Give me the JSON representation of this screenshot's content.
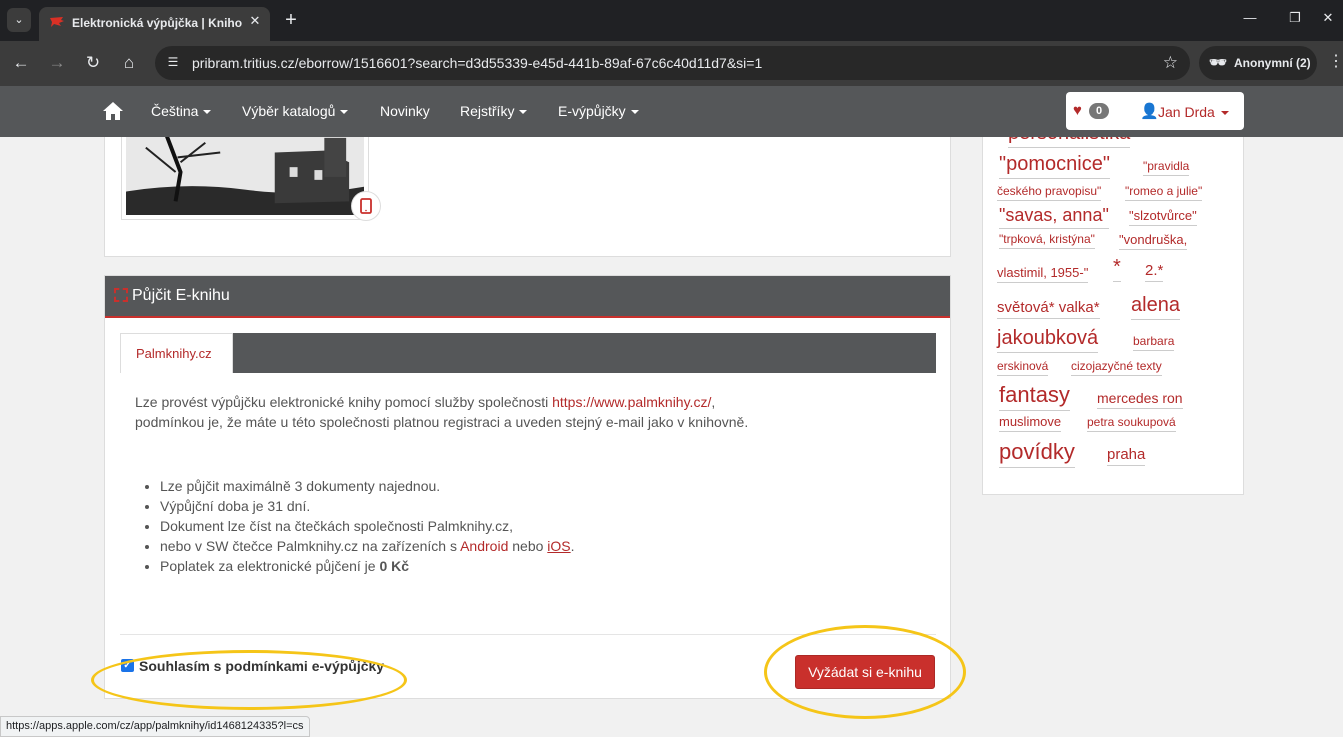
{
  "browser": {
    "tab_title": "Elektronická výpůjčka | Knihovna",
    "url": "pribram.tritius.cz/eborrow/1516601?search=d3d55339-e45d-441b-89af-67c6c40d11d7&si=1",
    "incognito_label": "Anonymní (2)",
    "status_url": "https://apps.apple.com/cz/app/palmknihy/id1468124335?l=cs"
  },
  "nav": {
    "items": [
      "Čeština",
      "Výběr katalogů",
      "Novinky",
      "Rejstříky",
      "E-výpůjčky"
    ],
    "favorites_count": "0",
    "user_name": "Jan Drda"
  },
  "panel": {
    "title": "Půjčit E-knihu",
    "tab_label": "Palmknihy.cz",
    "intro_before": "Lze provést výpůjčku elektronické knihy pomocí služby společnosti ",
    "intro_link": "https://www.palmknihy.cz/",
    "intro_after": ",",
    "intro_line2": "podmínkou je, že máte u této společnosti platnou registraci a uveden stejný e-mail jako v knihovně.",
    "rules": {
      "r1": "Lze půjčit maximálně 3 dokumenty najednou.",
      "r2": "Výpůjční doba je 31 dní.",
      "r3": "Dokument lze číst na čtečkách společnosti Palmknihy.cz,",
      "r4_before": "nebo v SW čtečce Palmknihy.cz na zařízeních s ",
      "r4_android": "Android",
      "r4_mid": " nebo ",
      "r4_ios": "iOS",
      "r4_after": ".",
      "r5_before": "Poplatek za elektronické půjčení je ",
      "r5_fee": "0 Kč"
    },
    "agree_label": "Souhlasím s podmínkami e-výpůjčky",
    "agree_checked": true,
    "request_button": "Vyžádat si e-knihu"
  },
  "tags": {
    "t0": "personalistika",
    "t1": "\"pomocnice\"",
    "t2": "\"pravidla",
    "t3": "českého pravopisu\"",
    "t4": "\"romeo a julie\"",
    "t5": "\"savas, anna\"",
    "t6": "\"slzotvůrce\"",
    "t7": "\"trpková, kristýna\"",
    "t8": "\"vondruška,",
    "t9": "vlastimil, 1955-\"",
    "t10": "*",
    "t11": "2.*",
    "t12": "světová* valka*",
    "t13": "alena",
    "t14": "jakoubková",
    "t15": "barbara",
    "t16": "erskinová",
    "t17": "cizojazyčné texty",
    "t18": "fantasy",
    "t19": "mercedes ron",
    "t20": "muslimove",
    "t21": "petra soukupová",
    "t22": "povídky",
    "t23": "praha"
  },
  "colors": {
    "accent": "#b32a2a",
    "button": "#c9302c",
    "nav_bg": "#555759",
    "highlight": "#f5c518"
  }
}
